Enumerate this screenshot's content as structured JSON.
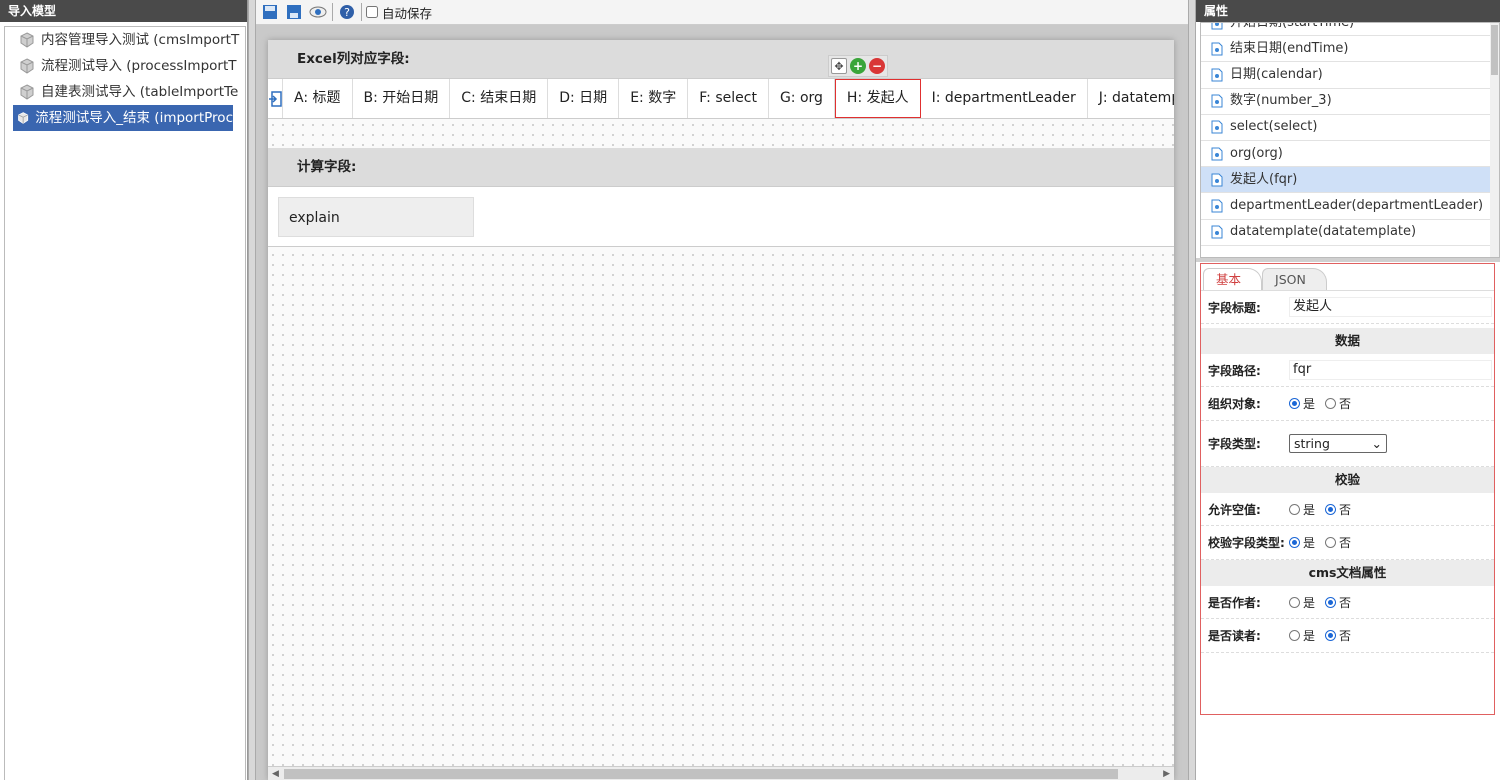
{
  "left_panel": {
    "title": "导入模型",
    "items": [
      {
        "label": "内容管理导入测试 (cmsImportT"
      },
      {
        "label": "流程测试导入 (processImportT"
      },
      {
        "label": "自建表测试导入 (tableImportTe"
      },
      {
        "label": "流程测试导入_结束 (importProc"
      }
    ]
  },
  "toolbar": {
    "autosave_label": "自动保存",
    "autosave_checked": false
  },
  "excel_section": {
    "title": "Excel列对应字段:",
    "columns": [
      "A: 标题",
      "B: 开始日期",
      "C: 结束日期",
      "D: 日期",
      "E: 数字",
      "F: select",
      "G: org",
      "H: 发起人",
      "I: departmentLeader",
      "J: datatemplate"
    ],
    "active_column": "H: 发起人"
  },
  "calc_section": {
    "title": "计算字段:",
    "fields": [
      "explain"
    ]
  },
  "right_panel": {
    "title": "属性",
    "fields": [
      "开始日期(startTime)",
      "结束日期(endTime)",
      "日期(calendar)",
      "数字(number_3)",
      "select(select)",
      "org(org)",
      "发起人(fqr)",
      "departmentLeader(departmentLeader)",
      "datatemplate(datatemplate)"
    ],
    "selected_field": "发起人(fqr)",
    "tabs": [
      "基本",
      "JSON"
    ],
    "props": {
      "field_title_label": "字段标题:",
      "field_title_value": "发起人",
      "group_data": "数据",
      "field_path_label": "字段路径:",
      "field_path_value": "fqr",
      "org_object_label": "组织对象:",
      "field_type_label": "字段类型:",
      "field_type_value": "string",
      "group_validate": "校验",
      "allow_empty_label": "允许空值:",
      "validate_type_label": "校验字段类型:",
      "group_cms": "cms文档属性",
      "is_author_label": "是否作者:",
      "is_reader_label": "是否读者:",
      "yes": "是",
      "no": "否"
    }
  },
  "colors": {
    "selection": "#3a66b0",
    "highlight_border": "#e03030",
    "list_selected": "#cfe0f7"
  }
}
